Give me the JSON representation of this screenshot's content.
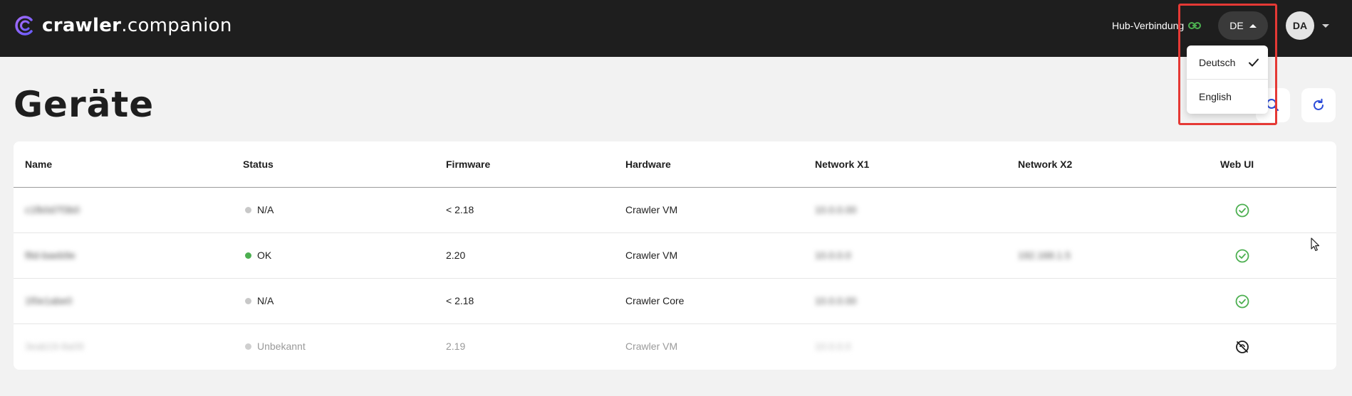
{
  "app": {
    "logo_bold": "crawler",
    "logo_light": ".companion",
    "hub_label": "Hub-Verbindung",
    "language_code": "DE",
    "user_initials": "DA"
  },
  "page": {
    "title": "Geräte"
  },
  "language_menu": {
    "items": [
      {
        "label": "Deutsch",
        "selected": true
      },
      {
        "label": "English",
        "selected": false
      }
    ]
  },
  "table": {
    "columns": [
      "Name",
      "Status",
      "Firmware",
      "Hardware",
      "Network X1",
      "Network X2",
      "Web UI"
    ],
    "rows": [
      {
        "name": "c1fb0d7f3b0",
        "status": "N/A",
        "status_color": "#c8c8c8",
        "firmware": "< 2.18",
        "hardware": "Crawler VM",
        "network_x1": "10.0.0.00",
        "network_x2": "",
        "web_ui": "available"
      },
      {
        "name": "f8d-baeb9e",
        "status": "OK",
        "status_color": "#4caf50",
        "firmware": "2.20",
        "hardware": "Crawler VM",
        "network_x1": "10.0.0.0",
        "network_x2": "192.168.1.5",
        "web_ui": "available"
      },
      {
        "name": "1f0e1abe0",
        "status": "N/A",
        "status_color": "#c8c8c8",
        "firmware": "< 2.18",
        "hardware": "Crawler Core",
        "network_x1": "10.0.0.00",
        "network_x2": "",
        "web_ui": "available"
      },
      {
        "name": "3eab19-8a09",
        "status": "Unbekannt",
        "status_color": "#cfcfcf",
        "firmware": "2.19",
        "hardware": "Crawler VM",
        "network_x1": "10.0.0.0",
        "network_x2": "",
        "web_ui": "unavailable"
      }
    ]
  },
  "colors": {
    "topbar": "#1e1e1e",
    "accent_blue": "#2b4bd8",
    "ok_green": "#4caf50",
    "highlight_red": "#e53935"
  }
}
